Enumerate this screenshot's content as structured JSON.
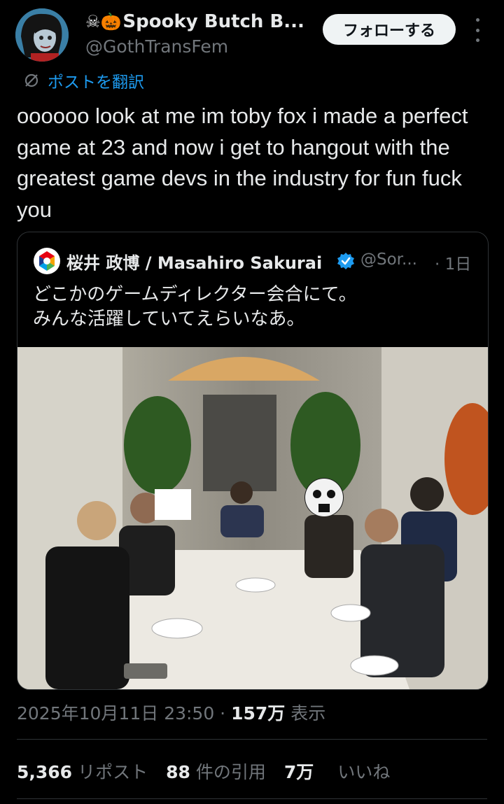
{
  "author": {
    "emoji": "☠🎃",
    "name": "Spooky Butch B...",
    "handle": "@GothTransFem",
    "follow_label": "フォローする"
  },
  "translate_label": "ポストを翻訳",
  "tweet_text": "oooooo look at me im toby fox i made a perfect game at 23 and now i get to hangout with the greatest game devs in the industry for fun fuck you",
  "quote": {
    "name": "桜井 政博 / Masahiro Sakurai",
    "handle": "@Sor...",
    "time": "· 1日",
    "text_line1": "どこかのゲームディレクター会合にて。",
    "text_line2": "みんな活躍していてえらいなあ。"
  },
  "meta": {
    "date": "2025年10月11日 23:50 · ",
    "views_count": "157万",
    "views_label": " 表示"
  },
  "stats": {
    "reposts_count": "5,366",
    "reposts_label": "リポスト",
    "quotes_count": "88",
    "quotes_label": "件の引用",
    "likes_count": "7万",
    "likes_label": "いいね"
  },
  "colors": {
    "background": "#000000",
    "text": "#e7e9ea",
    "muted": "#71767b",
    "link": "#1d9bf0",
    "border": "#2f3336"
  }
}
